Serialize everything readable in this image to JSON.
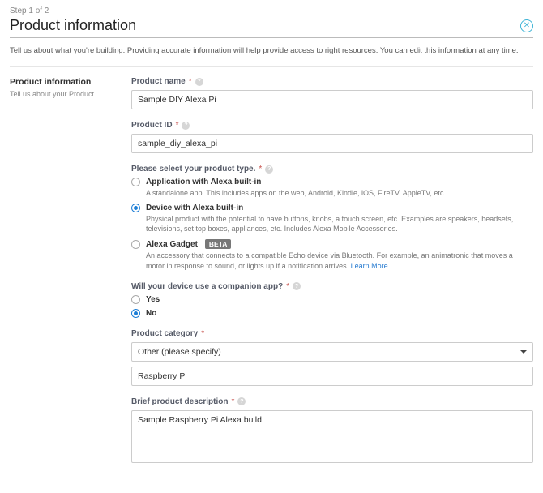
{
  "step": "Step 1 of 2",
  "page_title": "Product information",
  "intro_text": "Tell us about what you're building. Providing accurate information will help provide access to right resources. You can edit this information at any time.",
  "sidebar": {
    "heading": "Product information",
    "sub": "Tell us about your Product"
  },
  "fields": {
    "product_name": {
      "label": "Product name",
      "value": "Sample DIY Alexa Pi"
    },
    "product_id": {
      "label": "Product ID",
      "value": "sample_diy_alexa_pi"
    },
    "product_type": {
      "label": "Please select your product type.",
      "selected_index": 1,
      "options": [
        {
          "title": "Application with Alexa built-in",
          "desc": "A standalone app. This includes apps on the web, Android, Kindle, iOS, FireTV, AppleTV, etc."
        },
        {
          "title": "Device with Alexa built-in",
          "desc": "Physical product with the potential to have buttons, knobs, a touch screen, etc. Examples are speakers, headsets, televisions, set top boxes, appliances, etc. Includes Alexa Mobile Accessories."
        },
        {
          "title": "Alexa Gadget",
          "badge": "BETA",
          "desc_prefix": "An accessory that connects to a compatible Echo device via Bluetooth. For example, an animatronic that moves a motor in response to sound, or lights up if a notification arrives. ",
          "desc_link": "Learn More"
        }
      ]
    },
    "companion_app": {
      "label": "Will your device use a companion app?",
      "selected_index": 1,
      "options": [
        {
          "title": "Yes"
        },
        {
          "title": "No"
        }
      ]
    },
    "product_category": {
      "label": "Product category",
      "selected": "Other (please specify)",
      "other_value": "Raspberry Pi"
    },
    "description": {
      "label": "Brief product description",
      "value": "Sample Raspberry Pi Alexa build"
    }
  }
}
